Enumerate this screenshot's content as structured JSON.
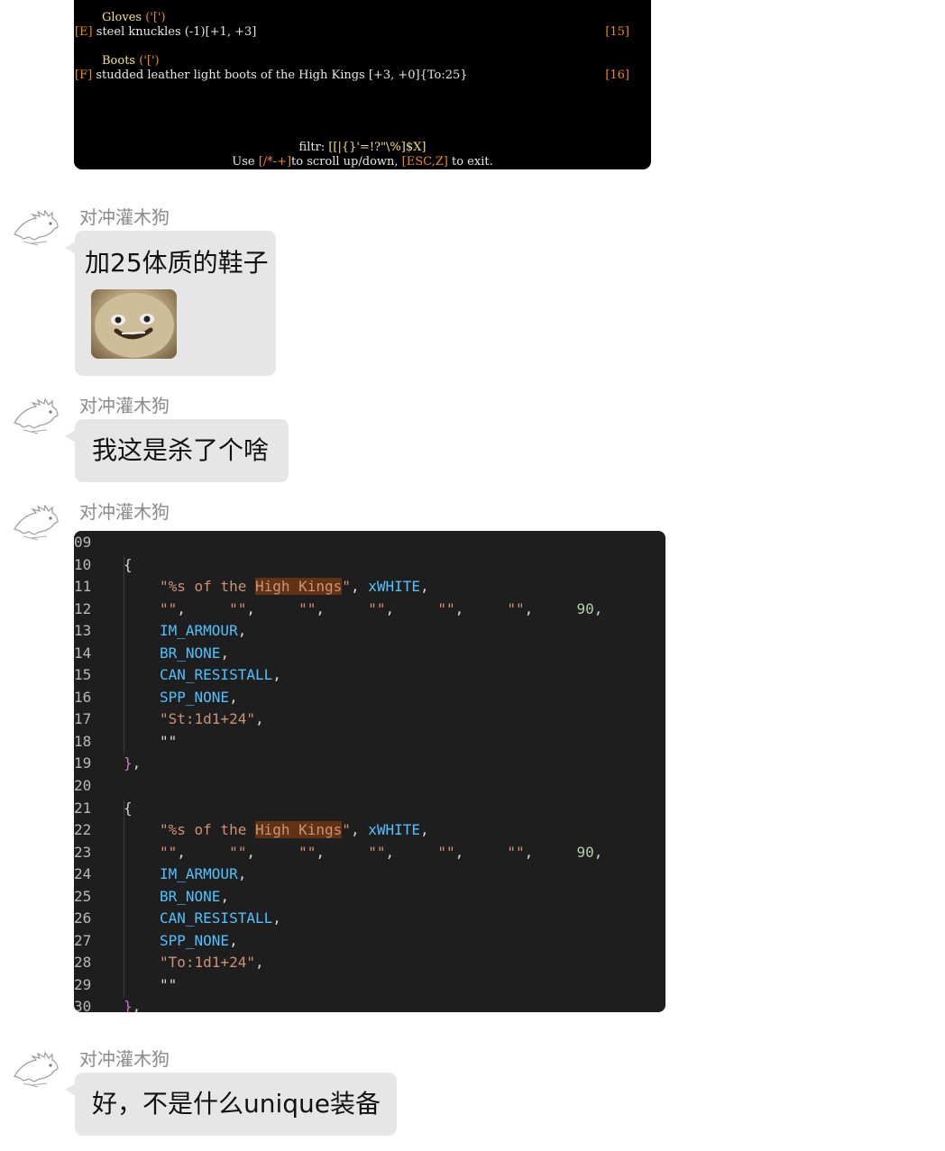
{
  "terminal": {
    "gloves_header": "Gloves",
    "gloves_glyph": "('[')",
    "gloves_slot": "[E]",
    "gloves_item": "steel knuckles (-1)[+1, +3]",
    "gloves_num": "[15]",
    "boots_header": "Boots",
    "boots_glyph": "('[')",
    "boots_slot": "[F]",
    "boots_item": "studded leather light boots of the High Kings [+3, +0]{To:25}",
    "boots_num": "[16]",
    "filter_label": "filtr:",
    "filter_value": "[[|{}'=!?\"\\%]$X]",
    "footer_pre": "Use",
    "footer_keys1": "[/*-+]",
    "footer_mid": "to scroll up/down,",
    "footer_keys2": "[ESC,Z]",
    "footer_post": "to exit."
  },
  "messages": [
    {
      "sender": "对冲灌木狗",
      "text": "加25体质的鞋子"
    },
    {
      "sender": "对冲灌木狗",
      "text": "我这是杀了个啥"
    },
    {
      "sender": "对冲灌木狗"
    },
    {
      "sender": "对冲灌木狗",
      "text": "好，不是什么unique装备"
    }
  ],
  "code": {
    "line_numbers": [
      "09",
      "10",
      "11",
      "12",
      "13",
      "14",
      "15",
      "16",
      "17",
      "18",
      "19",
      "20",
      "21",
      "22",
      "23",
      "24",
      "25",
      "26",
      "27",
      "28",
      "29",
      "30"
    ],
    "open_brace": "{",
    "close_brace": "},",
    "fmt_pre": "\"%s of the ",
    "fmt_hl": "High Kings",
    "fmt_post": "\"",
    "comma": ",",
    "color_id": "xWHITE",
    "empty_str": "\"\"",
    "num_90": "90",
    "im_armour": "IM_ARMOUR",
    "br_none": "BR_NONE",
    "can_resistall": "CAN_RESISTALL",
    "spp_none": "SPP_NONE",
    "st_str": "\"St:1d1+24\"",
    "to_str": "\"To:1d1+24\""
  }
}
